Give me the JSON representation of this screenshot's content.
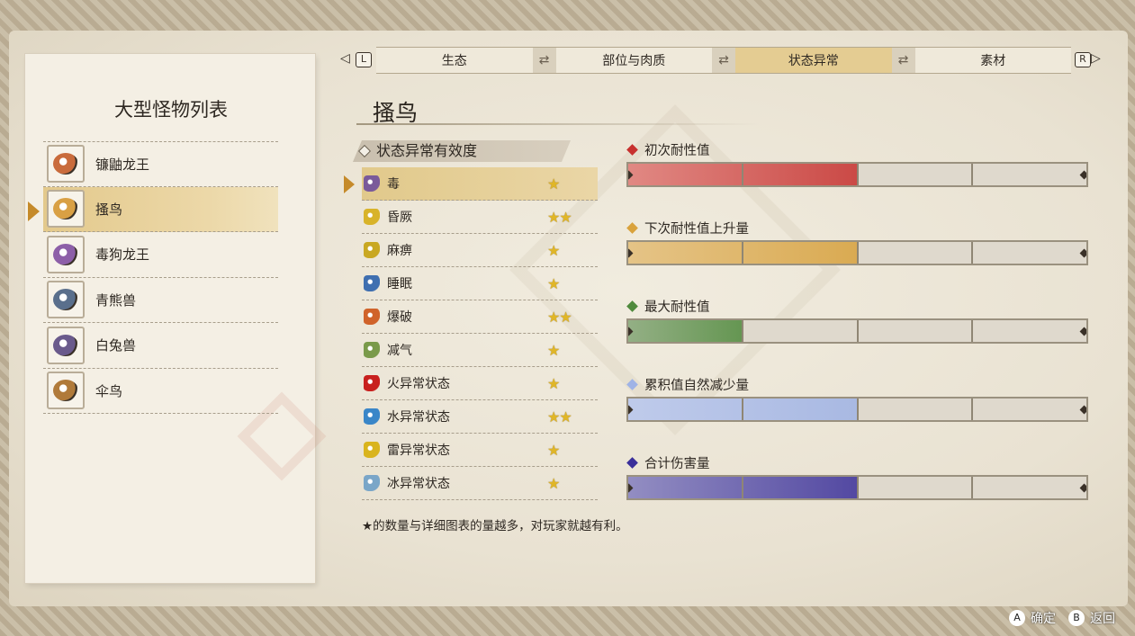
{
  "tabs": {
    "left_key": "L",
    "right_key": "R",
    "items": [
      "生态",
      "部位与肉质",
      "状态异常",
      "素材"
    ],
    "active_index": 2
  },
  "monster_list": {
    "title": "大型怪物列表",
    "items": [
      {
        "name": "镰鼬龙王",
        "icon": "kamaitachi-dragon-icon",
        "color": "#c96b3c"
      },
      {
        "name": "搔鸟",
        "icon": "kulu-bird-icon",
        "color": "#d9a044"
      },
      {
        "name": "毒狗龙王",
        "icon": "poison-dog-dragon-icon",
        "color": "#8d5fa8"
      },
      {
        "name": "青熊兽",
        "icon": "blue-bear-icon",
        "color": "#5a6f8c"
      },
      {
        "name": "白兔兽",
        "icon": "white-rabbit-beast-icon",
        "color": "#6a5a8c"
      },
      {
        "name": "伞鸟",
        "icon": "umbrella-bird-icon",
        "color": "#b07a3a"
      }
    ],
    "selected_index": 1
  },
  "monster_title": "搔鸟",
  "effectiveness": {
    "header": "状态异常有效度",
    "items": [
      {
        "name": "毒",
        "stars": "★",
        "icon": "poison-icon",
        "color": "#7a5a9a"
      },
      {
        "name": "昏厥",
        "stars": "★★",
        "icon": "stun-icon",
        "color": "#d8b32a"
      },
      {
        "name": "麻痹",
        "stars": "★",
        "icon": "paralysis-icon",
        "color": "#c9a822"
      },
      {
        "name": "睡眠",
        "stars": "★",
        "icon": "sleep-icon",
        "color": "#3f6fb0"
      },
      {
        "name": "爆破",
        "stars": "★★",
        "icon": "blast-icon",
        "color": "#d0632a"
      },
      {
        "name": "减气",
        "stars": "★",
        "icon": "exhaust-icon",
        "color": "#7a9a4a"
      },
      {
        "name": "火异常状态",
        "stars": "★",
        "icon": "fire-icon",
        "color": "#c8201e"
      },
      {
        "name": "水异常状态",
        "stars": "★★",
        "icon": "water-icon",
        "color": "#3a86c8"
      },
      {
        "name": "雷异常状态",
        "stars": "★",
        "icon": "thunder-icon",
        "color": "#d9b41e"
      },
      {
        "name": "冰异常状态",
        "stars": "★",
        "icon": "ice-icon",
        "color": "#7aa6c8"
      }
    ],
    "selected_index": 0
  },
  "metrics": [
    {
      "label": "初次耐性值",
      "color": "#c7302e",
      "fill_color": "#e17a76",
      "level": 0.5
    },
    {
      "label": "下次耐性值上升量",
      "color": "#d9a23c",
      "fill_color": "#e6c07a",
      "level": 0.5
    },
    {
      "label": "最大耐性值",
      "color": "#4f8a3c",
      "fill_color": "#86a878",
      "level": 0.25
    },
    {
      "label": "累积值自然减少量",
      "color": "#9fb3e6",
      "fill_color": "#b9c8f0",
      "level": 0.5
    },
    {
      "label": "合计伤害量",
      "color": "#3a2f9a",
      "fill_color": "#8580c0",
      "level": 0.5
    }
  ],
  "footnote": "★的数量与详细图表的量越多，对玩家就越有利。",
  "controls": {
    "confirm_key": "A",
    "confirm_label": "确定",
    "back_key": "B",
    "back_label": "返回"
  }
}
